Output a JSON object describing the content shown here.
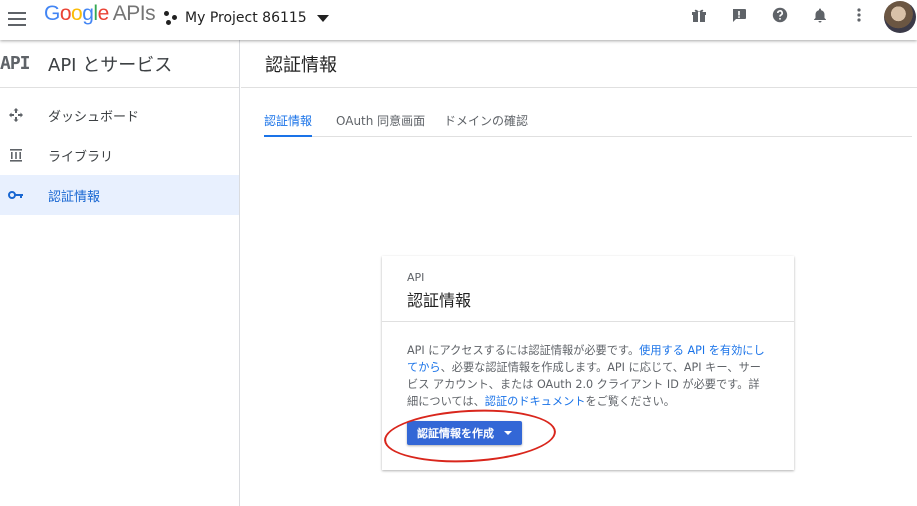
{
  "topbar": {
    "logo": {
      "g1": "G",
      "g2": "o",
      "g3": "o",
      "g4": "g",
      "g5": "l",
      "g6": "e",
      "apis": "APIs"
    },
    "project_name": "My Project 86115",
    "icons": [
      "gift-icon",
      "feedback-icon",
      "help-icon",
      "notifications-icon",
      "more-vert-icon"
    ]
  },
  "sidebar": {
    "badge": "API",
    "title": "API とサービス",
    "items": [
      {
        "label": "ダッシュボード",
        "icon": "dashboard-icon",
        "active": false
      },
      {
        "label": "ライブラリ",
        "icon": "library-icon",
        "active": false
      },
      {
        "label": "認証情報",
        "icon": "key-icon",
        "active": true
      }
    ]
  },
  "main": {
    "title": "認証情報",
    "tabs": [
      {
        "label": "認証情報",
        "active": true
      },
      {
        "label": "OAuth 同意画面",
        "active": false
      },
      {
        "label": "ドメインの確認",
        "active": false
      }
    ]
  },
  "card": {
    "subtitle": "API",
    "title": "認証情報",
    "body_part1": "API にアクセスするには認証情報が必要です。",
    "link1": "使用する API を有効にしてから",
    "body_part2": "、必要な認証情報を作成します。API に応じて、API キー、サービス アカウント、または OAuth 2.0 クライアント ID が必要です。詳細については、",
    "link2": "認証のドキュメント",
    "body_part3": "をご覧ください。",
    "button_label": "認証情報を作成"
  },
  "colors": {
    "accent": "#1a73e8",
    "button": "#3367d6",
    "active_nav_bg": "#e8f0fe",
    "annotation": "#d9261c"
  }
}
